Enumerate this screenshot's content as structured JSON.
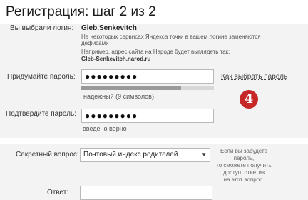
{
  "page": {
    "title": "Регистрация: шаг 2 из 2"
  },
  "login": {
    "label": "Вы выбрали логин:",
    "value": "Gleb.Senkevitch",
    "note_line1": "Не некоторых сервисах Яндекса точки в вашем логине заменяются",
    "note_line2": "дефисами",
    "note_line3": "Например, адрес сайта на Народе будет выглядеть так:",
    "example": "Gleb-Senkevitch.narod.ru"
  },
  "password": {
    "label": "Придумайте пароль:",
    "value": "●●●●●●●●●",
    "help_link": "Как выбрать пароль",
    "strength_text": "надежный (9 символов)",
    "strength_level": 0.75
  },
  "confirm": {
    "label": "Подтвердите пароль:",
    "value": "●●●●●●●●●",
    "status": "введено верно"
  },
  "badge": {
    "text": "4",
    "color": "#c62828"
  },
  "secret": {
    "label": "Секретный вопрос:",
    "selected": "Почтовый индекс родителей",
    "hint_line1": "Если вы забудете пароль,",
    "hint_line2": "то сможете получить",
    "hint_line3": "доступ, ответив",
    "hint_line4": "на этот вопрос."
  },
  "answer": {
    "label": "Ответ:",
    "value": ""
  }
}
